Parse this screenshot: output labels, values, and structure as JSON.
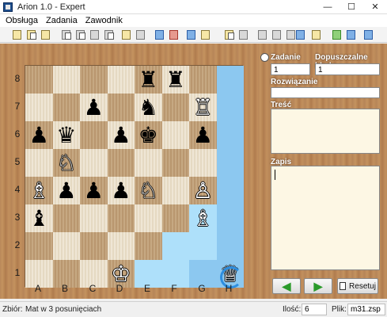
{
  "window": {
    "title": "Arion 1.0 - Expert",
    "controls": [
      "—",
      "☐",
      "✕"
    ]
  },
  "menu": [
    "Obsługa",
    "Zadania",
    "Zawodnik"
  ],
  "toolbar": {
    "icons": [
      "open-task-icon",
      "add-task-icon",
      "save-task-icon",
      "copy-icon",
      "paste-icon",
      "edit-icon",
      "properties-icon",
      "folder-icon",
      "settings-icon",
      "user-icon",
      "users-icon",
      "player-card-icon",
      "stats-icon",
      "sort-icon",
      "filter-icon",
      "list-icon",
      "ranking-icon",
      "report-icon",
      "chart-icon",
      "save-disk-icon",
      "stack-icon"
    ]
  },
  "board": {
    "ranks": [
      "8",
      "7",
      "6",
      "5",
      "4",
      "3",
      "2",
      "1"
    ],
    "files": [
      "A",
      "B",
      "C",
      "D",
      "E",
      "F",
      "G",
      "H"
    ],
    "highlight_dark": [
      "h8",
      "h7",
      "h6",
      "h5",
      "h4",
      "h3",
      "h2",
      "g1",
      "h1",
      "e1",
      "f1"
    ],
    "highlight_light": [
      "g3",
      "g2",
      "f2",
      "f1",
      "e1"
    ],
    "pieces": [
      {
        "sq": "e8",
        "piece": "♜",
        "color": "black"
      },
      {
        "sq": "f8",
        "piece": "♜",
        "color": "black"
      },
      {
        "sq": "c7",
        "piece": "♟",
        "color": "black"
      },
      {
        "sq": "e7",
        "piece": "♞",
        "color": "black"
      },
      {
        "sq": "g7",
        "piece": "♖",
        "color": "white"
      },
      {
        "sq": "a6",
        "piece": "♟",
        "color": "black"
      },
      {
        "sq": "b6",
        "piece": "♛",
        "color": "black"
      },
      {
        "sq": "d6",
        "piece": "♟",
        "color": "black"
      },
      {
        "sq": "e6",
        "piece": "♚",
        "color": "black"
      },
      {
        "sq": "g6",
        "piece": "♟",
        "color": "black"
      },
      {
        "sq": "b5",
        "piece": "♘",
        "color": "white"
      },
      {
        "sq": "a4",
        "piece": "♗",
        "color": "white"
      },
      {
        "sq": "b4",
        "piece": "♟",
        "color": "black"
      },
      {
        "sq": "c4",
        "piece": "♟",
        "color": "black"
      },
      {
        "sq": "d4",
        "piece": "♟",
        "color": "black"
      },
      {
        "sq": "e4",
        "piece": "♘",
        "color": "white"
      },
      {
        "sq": "g4",
        "piece": "♙",
        "color": "white"
      },
      {
        "sq": "a3",
        "piece": "♝",
        "color": "black"
      },
      {
        "sq": "g3",
        "piece": "♗",
        "color": "white"
      },
      {
        "sq": "d1",
        "piece": "♔",
        "color": "white"
      },
      {
        "sq": "h1",
        "piece": "♕",
        "color": "white"
      }
    ]
  },
  "panel": {
    "task_label": "Zadanie",
    "task_value": "1",
    "errors_label": "Dopuszczalne błędy",
    "errors_value": "1",
    "solution_label": "Rozwiązanie",
    "solution_value": "",
    "content_label": "Treść",
    "content_value": "",
    "record_label": "Zapis",
    "record_value": "",
    "back_arrow": "◀",
    "forward_arrow": "▶",
    "reset_label": "Resetuj"
  },
  "status": {
    "set_label": "Zbiór:",
    "set_value": "Mat w 3 posunięciach",
    "count_label": "Ilość:",
    "count_value": "6",
    "file_label": "Plik:",
    "file_value": "m31.zsp"
  }
}
